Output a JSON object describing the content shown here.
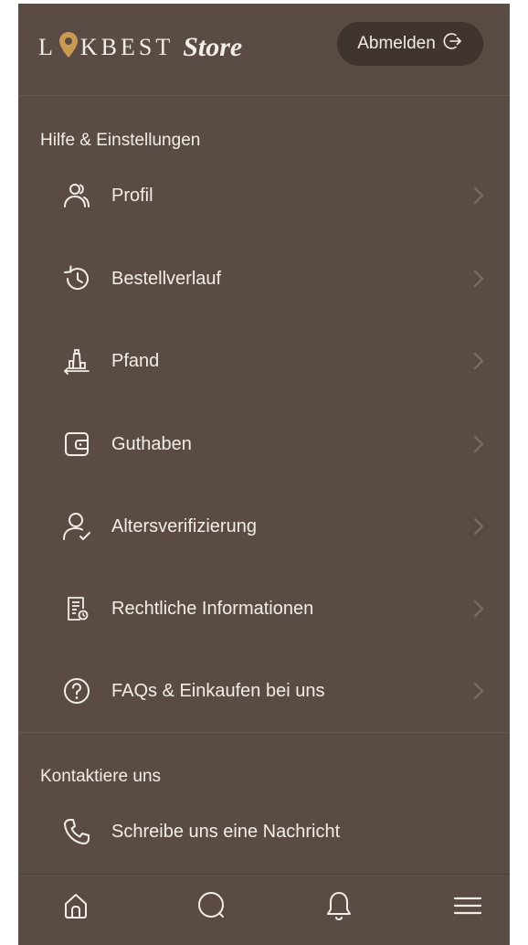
{
  "header": {
    "logo_text_left": "L",
    "logo_text_right": "KBEST",
    "logo_store": "Store",
    "logout_label": "Abmelden"
  },
  "sections": {
    "help_title": "Hilfe & Einstellungen",
    "contact_title": "Kontaktiere uns"
  },
  "menu": {
    "items": [
      {
        "label": "Profil",
        "icon": "profile-icon"
      },
      {
        "label": "Bestellverlauf",
        "icon": "history-icon"
      },
      {
        "label": "Pfand",
        "icon": "deposit-icon"
      },
      {
        "label": "Guthaben",
        "icon": "wallet-icon"
      },
      {
        "label": "Altersverifizierung",
        "icon": "age-verification-icon"
      },
      {
        "label": "Rechtliche Informationen",
        "icon": "legal-document-icon"
      },
      {
        "label": "FAQs & Einkaufen bei uns",
        "icon": "help-question-icon"
      }
    ]
  },
  "contact": {
    "message_label": "Schreibe uns eine Nachricht",
    "icon": "phone-icon"
  },
  "bottom_nav": {
    "items": [
      {
        "icon": "home-icon"
      },
      {
        "icon": "search-icon"
      },
      {
        "icon": "bell-icon"
      },
      {
        "icon": "menu-icon"
      }
    ]
  },
  "colors": {
    "background": "#5a4c44",
    "logout_button": "#3f342e",
    "text": "#f2ede8",
    "accent_pin": "#c99a52",
    "chevron": "#7d6f66"
  }
}
